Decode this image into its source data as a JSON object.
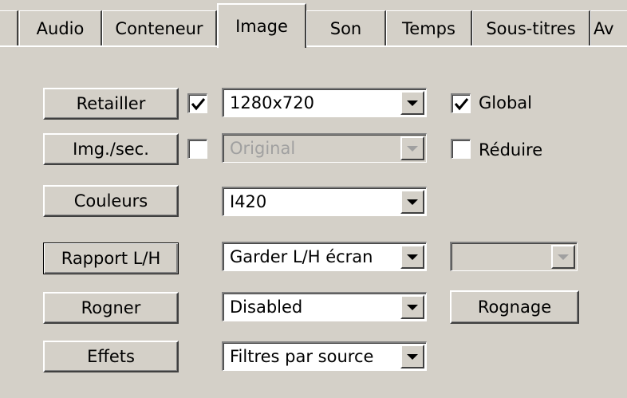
{
  "tabs": [
    {
      "label": "Audio",
      "active": false
    },
    {
      "label": "Conteneur",
      "active": false
    },
    {
      "label": "Image",
      "active": true
    },
    {
      "label": "Son",
      "active": false
    },
    {
      "label": "Temps",
      "active": false
    },
    {
      "label": "Sous-titres",
      "active": false
    },
    {
      "label": "Av",
      "active": false
    }
  ],
  "rows": {
    "resize": {
      "button": "Retailler",
      "checked": true,
      "value": "1280x720",
      "global_label": "Global",
      "global_checked": true
    },
    "fps": {
      "button": "Img./sec.",
      "checked": false,
      "value": "Original",
      "reduce_label": "Réduire",
      "reduce_checked": false
    },
    "colors": {
      "button": "Couleurs",
      "value": "I420"
    },
    "aspect": {
      "button": "Rapport L/H",
      "value": "Garder L/H écran",
      "extra_value": ""
    },
    "crop": {
      "button": "Rogner",
      "value": "Disabled",
      "crop_button": "Rognage"
    },
    "effects": {
      "button": "Effets",
      "value": "Filtres par source"
    }
  }
}
